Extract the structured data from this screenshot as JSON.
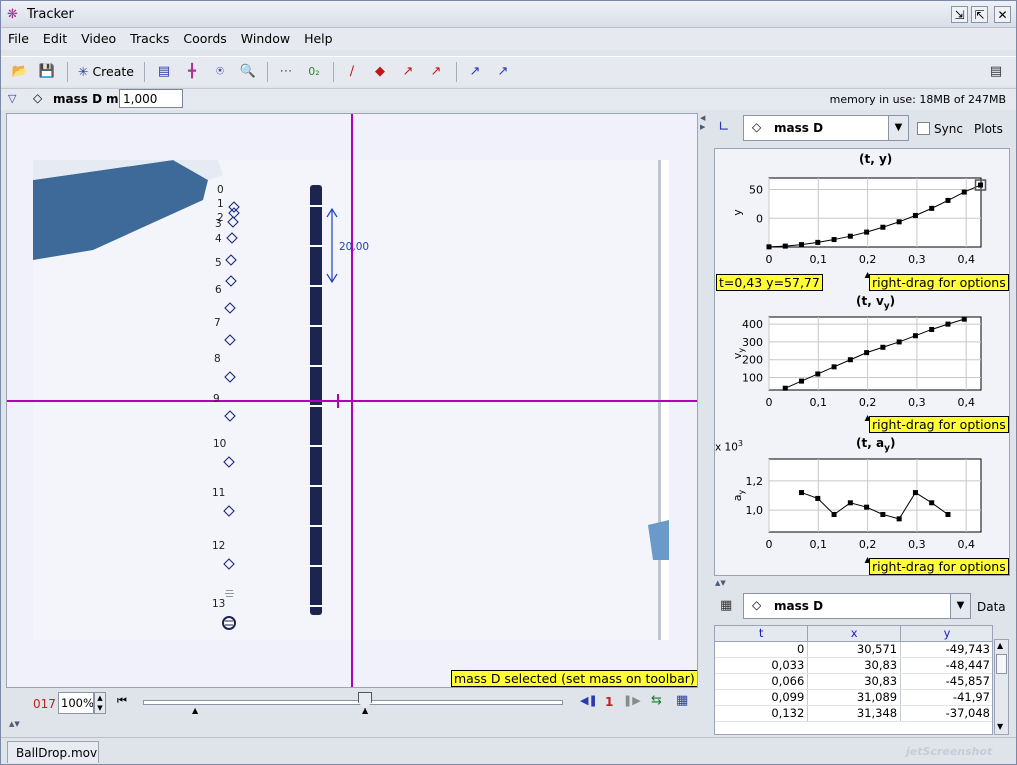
{
  "window": {
    "title": "Tracker",
    "app_icon": "tracker-logo-icon"
  },
  "menu": [
    "File",
    "Edit",
    "Video",
    "Tracks",
    "Coords",
    "Window",
    "Help"
  ],
  "toolbar": {
    "create_label": "Create"
  },
  "trackbar": {
    "track_name": "mass D",
    "mass_label": "m",
    "mass_value": "1,000",
    "memory": "memory in use: 18MB of 247MB"
  },
  "video": {
    "point_labels": [
      "0",
      "1",
      "2",
      "3",
      "4",
      "5",
      "6",
      "7",
      "8",
      "9",
      "10",
      "11",
      "12",
      "13"
    ],
    "calibration_label": "20,00",
    "status": "mass D selected (set mass on toolbar)"
  },
  "player": {
    "frame": "017",
    "zoom": "100%",
    "step": "1"
  },
  "plots": {
    "track_name": "mass D",
    "sync_label": "Sync",
    "plots_label": "Plots",
    "readout": "t=0,43  y=57,77",
    "options_hint": "right-drag for options",
    "x_ticks": [
      "0",
      "0,1",
      "0,2",
      "0,3",
      "0,4"
    ],
    "plot1": {
      "title": "(t, y)",
      "ylabel": "y",
      "y_ticks": [
        "50",
        "0"
      ]
    },
    "plot2": {
      "title": "(t, v",
      "title_sub": "y",
      "title_close": ")",
      "ylabel": "v",
      "ylabel_sub": "y",
      "y_ticks": [
        "400",
        "300",
        "200",
        "100"
      ]
    },
    "plot3": {
      "title": "(t, a",
      "title_sub": "y",
      "title_close": ")",
      "ylabel": "a",
      "ylabel_sub": "y",
      "multiplier": "x 10",
      "multiplier_exp": "3",
      "y_ticks": [
        "1,2",
        "1,0"
      ]
    }
  },
  "chart_data": [
    {
      "type": "scatter",
      "title": "(t, y)",
      "xlabel": "",
      "ylabel": "y",
      "xlim": [
        0,
        0.43
      ],
      "ylim": [
        -50,
        70
      ],
      "x": [
        0,
        0.033,
        0.066,
        0.099,
        0.132,
        0.165,
        0.198,
        0.231,
        0.264,
        0.297,
        0.33,
        0.363,
        0.396,
        0.429
      ],
      "y": [
        -49.743,
        -48.447,
        -45.857,
        -41.97,
        -37.048,
        -31.2,
        -24.1,
        -15.6,
        -6.2,
        4.8,
        17.2,
        31.0,
        45.5,
        57.77
      ]
    },
    {
      "type": "scatter",
      "title": "(t, vy)",
      "xlabel": "",
      "ylabel": "vy",
      "xlim": [
        0,
        0.43
      ],
      "ylim": [
        30,
        440
      ],
      "x": [
        0.033,
        0.066,
        0.099,
        0.132,
        0.165,
        0.198,
        0.231,
        0.264,
        0.297,
        0.33,
        0.363,
        0.396
      ],
      "y": [
        40,
        80,
        120,
        160,
        200,
        240,
        270,
        300,
        335,
        370,
        400,
        428
      ]
    },
    {
      "type": "scatter",
      "title": "(t, ay)",
      "xlabel": "",
      "ylabel": "ay",
      "xlim": [
        0,
        0.43
      ],
      "ylim": [
        0.85,
        1.35
      ],
      "x": [
        0.066,
        0.099,
        0.132,
        0.165,
        0.198,
        0.231,
        0.264,
        0.297,
        0.33,
        0.363
      ],
      "y": [
        1.12,
        1.08,
        0.97,
        1.05,
        1.02,
        0.97,
        0.94,
        1.12,
        1.05,
        0.97
      ]
    }
  ],
  "table": {
    "track_name": "mass D",
    "data_label": "Data",
    "columns": [
      "t",
      "x",
      "y"
    ],
    "rows": [
      [
        "0",
        "30,571",
        "-49,743"
      ],
      [
        "0,033",
        "30,83",
        "-48,447"
      ],
      [
        "0,066",
        "30,83",
        "-45,857"
      ],
      [
        "0,099",
        "31,089",
        "-41,97"
      ],
      [
        "0,132",
        "31,348",
        "-37,048"
      ]
    ]
  },
  "tabs": [
    "BallDrop.mov"
  ],
  "watermark": "jetScreenshot"
}
